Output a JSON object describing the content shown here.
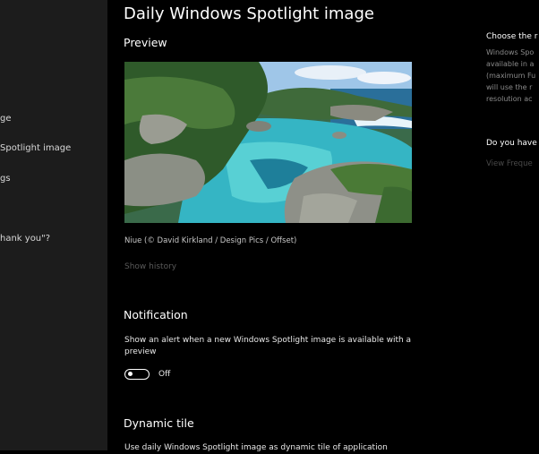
{
  "sidebar": {
    "items": [
      {
        "label": "ge"
      },
      {
        "label": "Spotlight image"
      },
      {
        "label": "gs"
      },
      {
        "label": "hank you\"?"
      }
    ]
  },
  "main": {
    "page_title": "Daily Windows Spotlight image",
    "preview": {
      "title": "Preview",
      "caption": "Niue (© David Kirkland / Design Pics / Offset)",
      "show_history": "Show history"
    },
    "notification": {
      "title": "Notification",
      "description": "Show an alert when a new Windows Spotlight image is available with a preview",
      "toggle_state": "Off"
    },
    "dynamic_tile": {
      "title": "Dynamic tile",
      "description": "Use daily Windows Spotlight image as dynamic tile of application"
    }
  },
  "right_panel": {
    "heading_1": "Choose the r",
    "text_lines": [
      "Windows Spo",
      "available in a",
      "(maximum Fu",
      "will use the r",
      "resolution ac"
    ],
    "heading_2": "Do you have",
    "link": "View Freque"
  },
  "colors": {
    "background": "#000000",
    "sidebar": "#1c1c1c",
    "text_primary": "#ffffff",
    "text_dim": "#5a5a5a"
  }
}
